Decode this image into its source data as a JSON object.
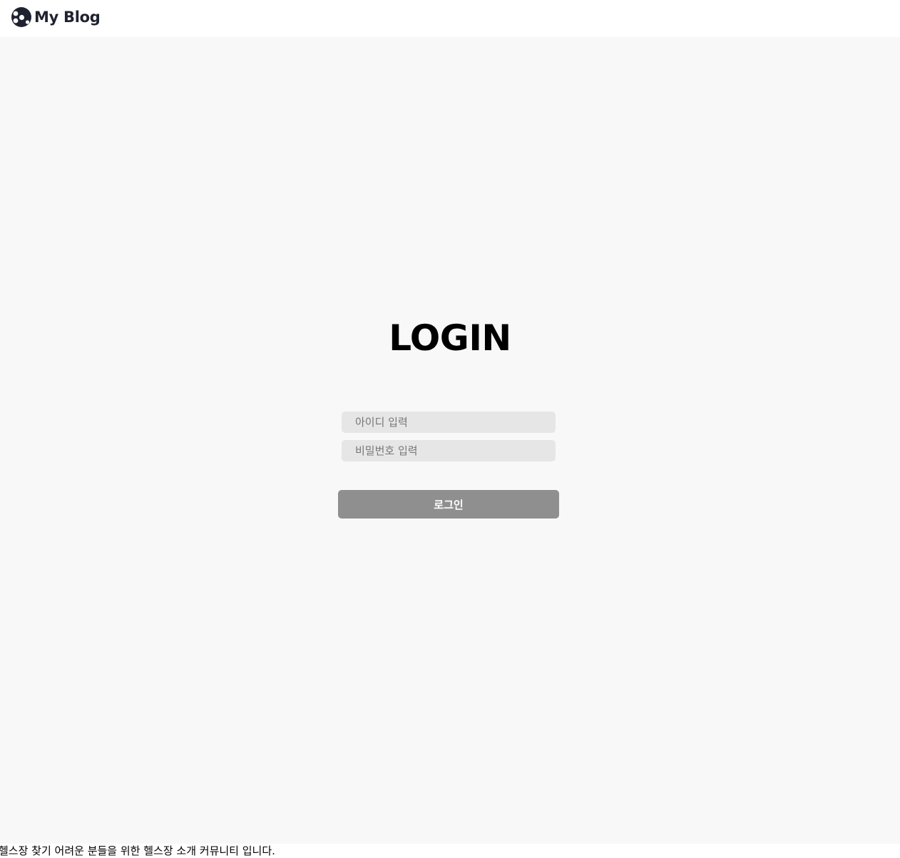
{
  "header": {
    "brand_name": "My Blog",
    "logo_icon": "blog-logo-icon",
    "brand_color": "#1f2330"
  },
  "main": {
    "title": "LOGIN",
    "background": "#f8f8f8",
    "id_field": {
      "placeholder": "아이디 입력",
      "value": ""
    },
    "password_field": {
      "placeholder": "비밀번호 입력",
      "value": ""
    },
    "login_button": {
      "label": "로그인",
      "color": "#8f8f8f"
    }
  },
  "footer": {
    "text": "헬스장 찾기 어려운 분들을 위한 헬스장 소개 커뮤니티 입니다."
  }
}
